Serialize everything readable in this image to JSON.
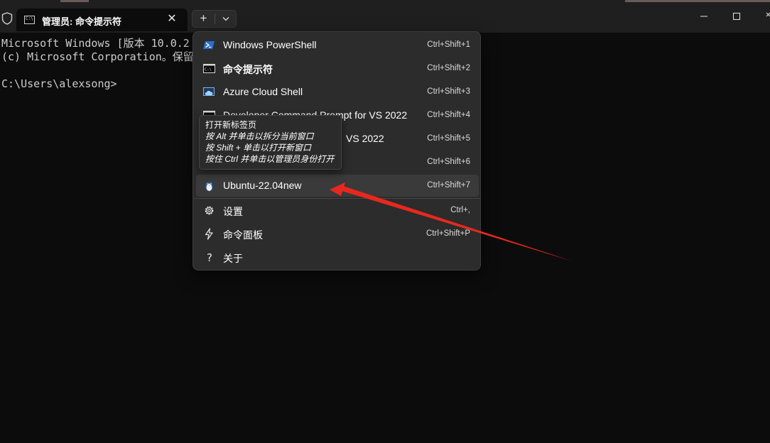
{
  "tab": {
    "title": "管理员: 命令提示符",
    "icon_text": "C:\\.",
    "close_glyph": "✕"
  },
  "toolbar": {
    "new_tab_glyph": "+"
  },
  "terminal": {
    "lines": [
      "Microsoft Windows [版本 10.0.2",
      "(c) Microsoft Corporation。保留",
      "",
      "C:\\Users\\alexsong>"
    ]
  },
  "menu": {
    "profiles": [
      {
        "label": "Windows PowerShell",
        "shortcut": "Ctrl+Shift+1",
        "icon": "powershell-icon"
      },
      {
        "label": "命令提示符",
        "shortcut": "Ctrl+Shift+2",
        "icon": "cmd-icon"
      },
      {
        "label": "Azure Cloud Shell",
        "shortcut": "Ctrl+Shift+3",
        "icon": "azure-cloud-icon"
      },
      {
        "label": "Developer Command Prompt for VS 2022",
        "shortcut": "Ctrl+Shift+4",
        "icon": "cmd-icon"
      },
      {
        "label": "Developer PowerShell for VS 2022",
        "label_visible": "VS 2022",
        "shortcut": "Ctrl+Shift+5",
        "icon": "powershell-icon"
      },
      {
        "label": "",
        "shortcut": "Ctrl+Shift+6",
        "icon": "cmd-icon"
      },
      {
        "label": "Ubuntu-22.04new",
        "shortcut": "Ctrl+Shift+7",
        "icon": "ubuntu-penguin-icon"
      }
    ],
    "actions": [
      {
        "label": "设置",
        "shortcut": "Ctrl+,",
        "icon": "gear-icon"
      },
      {
        "label": "命令面板",
        "shortcut": "Ctrl+Shift+P",
        "icon": "lightning-icon"
      },
      {
        "label": "关于",
        "shortcut": "",
        "icon": "question-icon"
      }
    ]
  },
  "tooltip": {
    "lines": [
      "打开新标签页",
      "按 Alt 并单击以拆分当前窗口",
      "按 Shift + 单击以打开新窗口",
      "按住 Ctrl 并单击以管理员身份打开"
    ]
  },
  "colors": {
    "background": "#0c0c0c",
    "titlebar": "#1f1f1f",
    "menu": "#2c2c2c",
    "annotation_arrow": "#e8281e"
  }
}
